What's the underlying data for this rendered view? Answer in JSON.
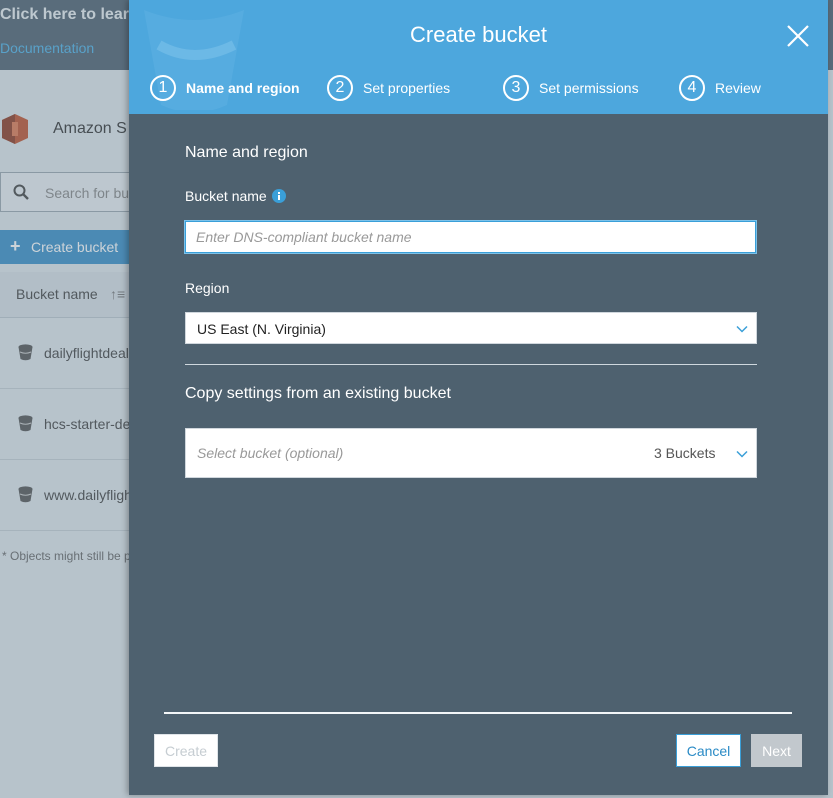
{
  "background": {
    "banner_title": "Click here to lear",
    "banner_link": "Documentation",
    "app_title": "Amazon S",
    "search_placeholder": "Search for bu",
    "create_button": "Create bucket",
    "column_header": "Bucket name",
    "rows": [
      "dailyflightdeal",
      "hcs-starter-de",
      "www.dailyfligh"
    ],
    "footnote": "* Objects might still be p"
  },
  "modal": {
    "title": "Create bucket",
    "steps": [
      {
        "number": "1",
        "label": "Name and region",
        "active": true
      },
      {
        "number": "2",
        "label": "Set properties",
        "active": false
      },
      {
        "number": "3",
        "label": "Set permissions",
        "active": false
      },
      {
        "number": "4",
        "label": "Review",
        "active": false
      }
    ],
    "section_title": "Name and region",
    "bucket_name_label": "Bucket name",
    "bucket_name_placeholder": "Enter DNS-compliant bucket name",
    "bucket_name_value": "",
    "region_label": "Region",
    "region_value": "US East (N. Virginia)",
    "copy_settings_title": "Copy settings from an existing bucket",
    "copy_select_placeholder": "Select bucket (optional)",
    "copy_select_count": "3 Buckets",
    "buttons": {
      "create": "Create",
      "cancel": "Cancel",
      "next": "Next"
    }
  },
  "colors": {
    "header": "#4da7dd",
    "modal_body": "#4e616f",
    "accent": "#3a9fd8",
    "disabled_button": "#c2c8cd"
  },
  "icons": {
    "close": "close-icon",
    "info": "info-icon",
    "chevron": "chevron-down-icon",
    "bucket": "bucket-icon",
    "search": "search-icon",
    "plus": "plus-icon",
    "logo": "s3-logo"
  }
}
